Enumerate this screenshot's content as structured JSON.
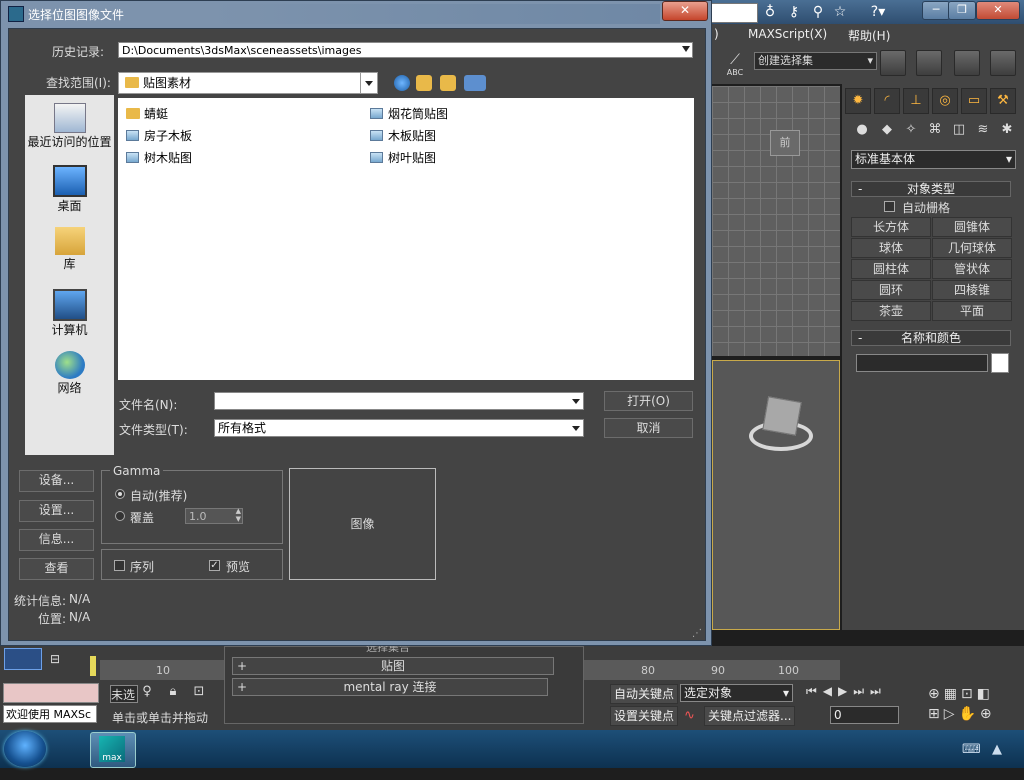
{
  "max": {
    "menu": {
      "mid": ")",
      "maxscript": "MAXScript(X)",
      "help": "帮助(H)"
    },
    "selection_set": "创建选择集",
    "toolbar_abc": "ABC",
    "viewport_label": "前",
    "command_panel": {
      "category_select": "标准基本体",
      "object_type": {
        "title": "对象类型",
        "autogrid": "自动栅格",
        "buttons": [
          "长方体",
          "圆锥体",
          "球体",
          "几何球体",
          "圆柱体",
          "管状体",
          "圆环",
          "四棱锥",
          "茶壶",
          "平面"
        ]
      },
      "name_color": {
        "title": "名称和颜色"
      }
    },
    "timeline": {
      "ticks": [
        "10",
        "80",
        "90",
        "100"
      ]
    },
    "rollouts": {
      "modifier_partial": "选择集合",
      "maps": "贴图",
      "mentalray": "mental ray 连接"
    },
    "bottom": {
      "unselected_partial": "未选",
      "auto_key": "自动关键点",
      "selected_object": "选定对象",
      "set_key": "设置关键点",
      "key_filter": "关键点过滤器...",
      "frame": "0",
      "welcome": "欢迎使用 MAXSc",
      "status": "单击或单击并拖动"
    }
  },
  "dialog": {
    "title": "选择位图图像文件",
    "close": "✕",
    "history_label": "历史记录:",
    "history_path": "D:\\Documents\\3dsMax\\sceneassets\\images",
    "lookin_label": "查找范围(I):",
    "lookin_value": "贴图素材",
    "places": [
      "最近访问的位置",
      "桌面",
      "库",
      "计算机",
      "网络"
    ],
    "files_col1": [
      "蜻蜓",
      "房子木板",
      "树木贴图"
    ],
    "files_col2": [
      "烟花筒贴图",
      "木板贴图",
      "树叶贴图"
    ],
    "filename_label": "文件名(N):",
    "filename_value": "",
    "filetype_label": "文件类型(T):",
    "filetype_value": "所有格式",
    "open": "打开(O)",
    "cancel": "取消",
    "device": "设备...",
    "setup": "设置...",
    "info": "信息...",
    "view": "查看",
    "gamma": {
      "title": "Gamma",
      "auto": "自动(推荐)",
      "override": "覆盖",
      "override_value": "1.0"
    },
    "sequence": "序列",
    "preview_chk": "预览",
    "preview_box": "图像",
    "stats_label": "统计信息:",
    "stats_value": "N/A",
    "location_label": "位置:",
    "location_value": "N/A"
  }
}
